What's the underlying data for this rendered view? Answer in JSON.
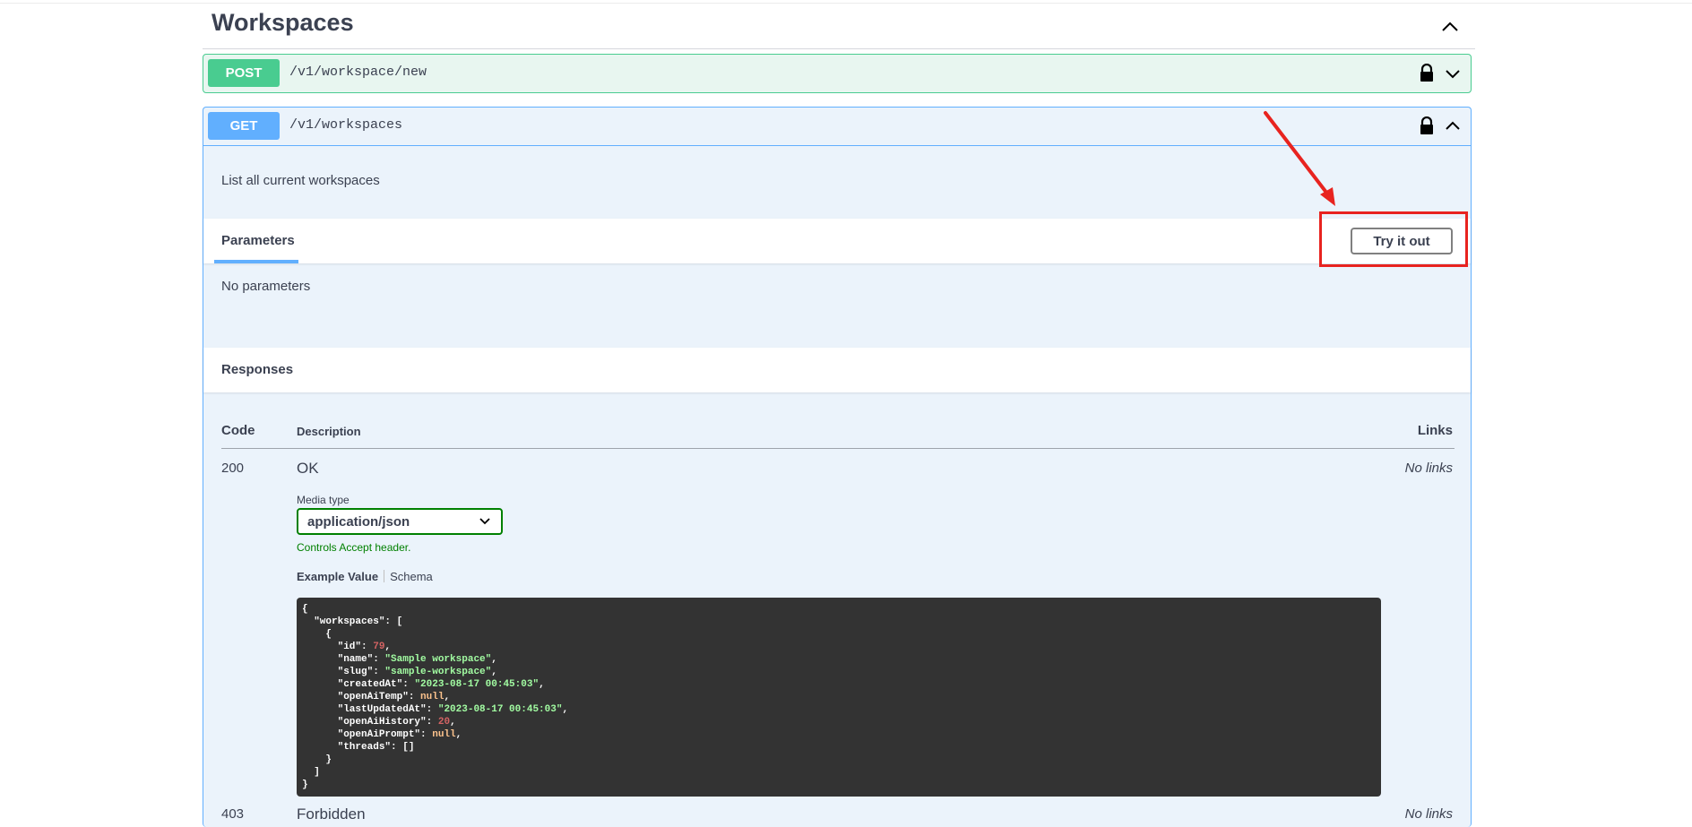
{
  "section": {
    "title": "Workspaces"
  },
  "operations": [
    {
      "method": "POST",
      "path": "/v1/workspace/new"
    },
    {
      "method": "GET",
      "path": "/v1/workspaces"
    }
  ],
  "get_op": {
    "description": "List all current workspaces",
    "parameters_tab": "Parameters",
    "try_button": "Try it out",
    "no_parameters": "No parameters",
    "responses_title": "Responses",
    "columns": {
      "code": "Code",
      "description": "Description",
      "links": "Links"
    },
    "responses": [
      {
        "code": "200",
        "description": "OK",
        "links": "No links"
      },
      {
        "code": "403",
        "description": "Forbidden",
        "links": "No links"
      }
    ],
    "media_type_label": "Media type",
    "media_type_value": "application/json",
    "controls_text": "Controls Accept header.",
    "example_tab": "Example Value",
    "schema_tab": "Schema",
    "example": {
      "open_brace": "{",
      "workspaces_key": "\"workspaces\"",
      "id_key": "\"id\"",
      "id_val": "79",
      "name_key": "\"name\"",
      "name_val": "\"Sample workspace\"",
      "slug_key": "\"slug\"",
      "slug_val": "\"sample-workspace\"",
      "created_key": "\"createdAt\"",
      "created_val": "\"2023-08-17 00:45:03\"",
      "temp_key": "\"openAiTemp\"",
      "temp_val": "null",
      "updated_key": "\"lastUpdatedAt\"",
      "updated_val": "\"2023-08-17 00:45:03\"",
      "history_key": "\"openAiHistory\"",
      "history_val": "20",
      "prompt_key": "\"openAiPrompt\"",
      "prompt_val": "null",
      "threads_key": "\"threads\"",
      "threads_val": "[]"
    }
  },
  "colors": {
    "post": "#49cc90",
    "get": "#61affe",
    "annotation": "#e8231f"
  },
  "icons": [
    "chevron-up-icon",
    "lock-icon",
    "chevron-down-icon"
  ]
}
